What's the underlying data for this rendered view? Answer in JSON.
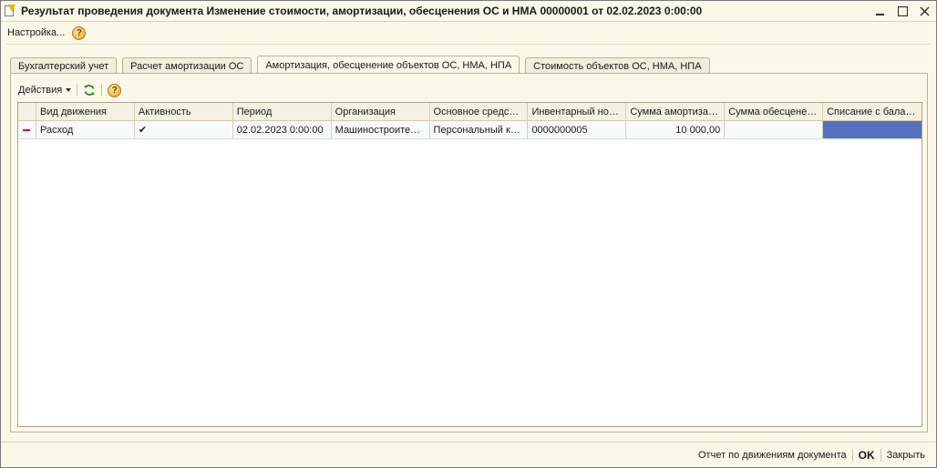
{
  "window": {
    "title": "Результат проведения документа Изменение стоимости, амортизации, обесценения ОС и НМА 00000001 от 02.02.2023 0:00:00"
  },
  "menu": {
    "settings_label": "Настройка...",
    "help_label": "?"
  },
  "tabs": [
    {
      "label": "Бухгалтерский учет",
      "active": false
    },
    {
      "label": "Расчет амортизации ОС",
      "active": false
    },
    {
      "label": "Амортизация, обесценение объектов ОС, НМА, НПА",
      "active": true
    },
    {
      "label": "Стоимость объектов ОС, НМА, НПА",
      "active": false
    }
  ],
  "toolbar": {
    "actions_label": "Действия",
    "help_label": "?"
  },
  "table": {
    "columns": [
      "Вид движения",
      "Активность",
      "Период",
      "Организация",
      "Основное средство",
      "Инвентарный ном...",
      "Сумма амортизац...",
      "Сумма обесценен...",
      "Списание с балан..."
    ],
    "rows": [
      {
        "movement_type": "Расход",
        "active": "✔",
        "period": "02.02.2023 0:00:00",
        "organization": "Машиностроитель...",
        "asset": "Персональный ко...",
        "inventory_number": "0000000005",
        "depreciation_sum": "10 000,00",
        "impairment_sum": "",
        "write_off": ""
      }
    ]
  },
  "footer": {
    "report_label": "Отчет по движениям документа",
    "ok_label": "OK",
    "close_label": "Закрыть"
  },
  "colors": {
    "window_bg": "#fbf8e9",
    "selection": "#5570c0",
    "active_tab_underline": "#d42020",
    "expense_mark": "#c01818"
  }
}
